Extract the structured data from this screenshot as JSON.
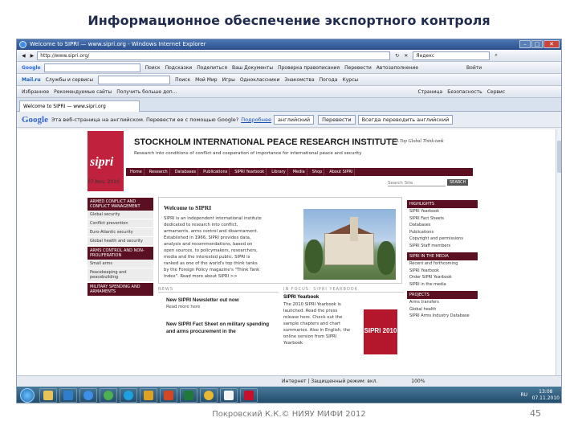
{
  "slide": {
    "title": "Информационное обеспечение экспортного контроля",
    "footer": "Покровский К.К.© НИЯУ МИФИ 2012",
    "page_number": "45"
  },
  "browser": {
    "window_title": "Welcome to SIPRI — www.sipri.org - Windows Internet Explorer",
    "address": "http://www.sipri.org/",
    "search_engine": "Яндекс",
    "google_label": "Google",
    "tab_label": "Welcome to SIPRI — www.sipri.org",
    "status_text": "Интернет | Защищенный режим: вкл.",
    "zoom": "100%"
  },
  "google_toolbar": {
    "items": [
      "Поиск",
      "Подсказки",
      "Поделиться",
      "Ваш Документы",
      "Проверка правописания",
      "Перевести",
      "Автозаполнение",
      "Войти"
    ]
  },
  "bookmarks": {
    "items": [
      "Mail.ru",
      "Службы и сервисы",
      "Поиск",
      "Мой Мир",
      "Игры",
      "Одноклассники",
      "Знакомства",
      "Погода",
      "Курсы"
    ]
  },
  "links_bar": {
    "items": [
      "Избранное",
      "Рекомендуемые сайты",
      "Получить больше доп..."
    ],
    "right_items": [
      "Страница",
      "Безопасность",
      "Сервис"
    ]
  },
  "translate_bar": {
    "logo": "Google",
    "message": "Эта веб-страница на английском. Перевести ее с помощью Google?",
    "link": "Подробнее",
    "language": "английский",
    "button": "Перевести",
    "option": "Всегда переводить английский"
  },
  "sipri": {
    "logo": "sipri",
    "institute": "STOCKHOLM INTERNATIONAL PEACE RESEARCH INSTITUTE",
    "tagline": "A Top Global Think-tank",
    "subtitle": "Research into conditions of conflict and cooperation of importance for international peace and security",
    "nav": [
      "Home",
      "Research",
      "Databases",
      "Publications",
      "SIPRI Yearbook",
      "Library",
      "Media",
      "Shop",
      "About SIPRI"
    ],
    "date": "07 Nov. 2010",
    "search_placeholder": "Search Site",
    "search_button": "SEARCH",
    "left_nav": [
      {
        "head": "ARMED CONFLICT AND CONFLICT MANAGEMENT",
        "items": [
          "Global security",
          "Conflict prevention",
          "Euro-Atlantic security",
          "Global health and security"
        ]
      },
      {
        "head": "ARMS CONTROL AND NON-PROLIFERATION",
        "items": [
          "Small arms",
          "Peacekeeping and peacebuilding"
        ]
      },
      {
        "head": "MILITARY SPENDING AND ARMAMENTS",
        "items": []
      }
    ],
    "welcome_title": "Welcome to SIPRI",
    "welcome_text": "SIPRI is an independent international institute dedicated to research into conflict, armaments, arms control and disarmament. Established in 1966, SIPRI provides data, analysis and recommendations, based on open sources, to policymakers, researchers, media and the interested public. SIPRI is ranked as one of the world's top think tanks by the Foreign Policy magazine's \"Think Tank Index\". Read more about SIPRI >>",
    "news_head": "NEWS",
    "news": [
      {
        "title": "New SIPRI Newsletter out now",
        "more": "Read more here"
      },
      {
        "title": "New SIPRI Fact Sheet on military spending and arms procurement in the",
        "more": ""
      }
    ],
    "yearbook_head": "IN FOCUS: SIPRI YEARBOOK",
    "yearbook_title": "SIPRI Yearbook",
    "yearbook_text": "The 2010 SIPRI Yearbook is launched. Read the press release here. Check out the sample chapters and chart summaries. Also in English, the online version from SIPRI Yearbook",
    "yearbook_cover": "SIPRI 2010",
    "right_col": [
      {
        "head": "HIGHLIGHTS",
        "items": [
          "SIPRI Yearbook",
          "SIPRI Fact Sheets",
          "Databases",
          "Publications",
          "Copyright and permissions",
          "SIPRI Staff members"
        ]
      },
      {
        "head": "SIPRI IN THE MEDIA",
        "items": [
          "Recent and forthcoming",
          "SIPRI Yearbook",
          "Order SIPRI Yearbook",
          "SIPRI in the media"
        ]
      },
      {
        "head": "PROJECTS",
        "items": [
          "Arms transfers",
          "Global health",
          "SIPRI Arms Industry Database"
        ]
      }
    ]
  },
  "taskbar": {
    "time": "13:08",
    "date": "07.11.2010",
    "tray": "RU"
  },
  "colors": {
    "sipri_red": "#c0223d",
    "sipri_nav": "#5a1020",
    "title_color": "#1f2c4e"
  }
}
